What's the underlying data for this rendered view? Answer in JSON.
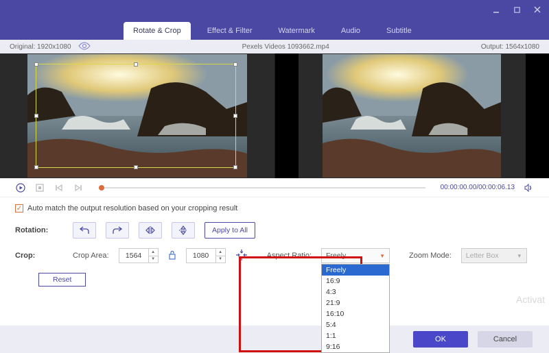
{
  "window": {
    "minimize_icon": "minimize",
    "close_icon": "close",
    "square_icon": "maximize"
  },
  "tabs": {
    "items": [
      {
        "label": "Rotate & Crop",
        "active": true
      },
      {
        "label": "Effect & Filter"
      },
      {
        "label": "Watermark"
      },
      {
        "label": "Audio"
      },
      {
        "label": "Subtitle"
      }
    ]
  },
  "infobar": {
    "original_label": "Original:",
    "original_value": "1920x1080",
    "filename": "Pexels Videos 1093662.mp4",
    "output_label": "Output:",
    "output_value": "1564x1080"
  },
  "playback": {
    "current": "00:00:00.00",
    "duration": "00:00:06.13"
  },
  "automatch": {
    "checked": true,
    "label": "Auto match the output resolution based on your cropping result"
  },
  "rotation": {
    "label": "Rotation:",
    "apply_all": "Apply to All"
  },
  "crop": {
    "label": "Crop:",
    "area_label": "Crop Area:",
    "width": "1564",
    "height": "1080",
    "aspect_label": "Aspect Ratio:",
    "aspect_selected": "Freely",
    "aspect_options": [
      "Freely",
      "16:9",
      "4:3",
      "21:9",
      "16:10",
      "5:4",
      "1:1",
      "9:16"
    ],
    "zoom_label": "Zoom Mode:",
    "zoom_selected": "Letter Box",
    "reset": "Reset"
  },
  "footer": {
    "ok": "OK",
    "cancel": "Cancel"
  },
  "watermark_text": "Activat"
}
